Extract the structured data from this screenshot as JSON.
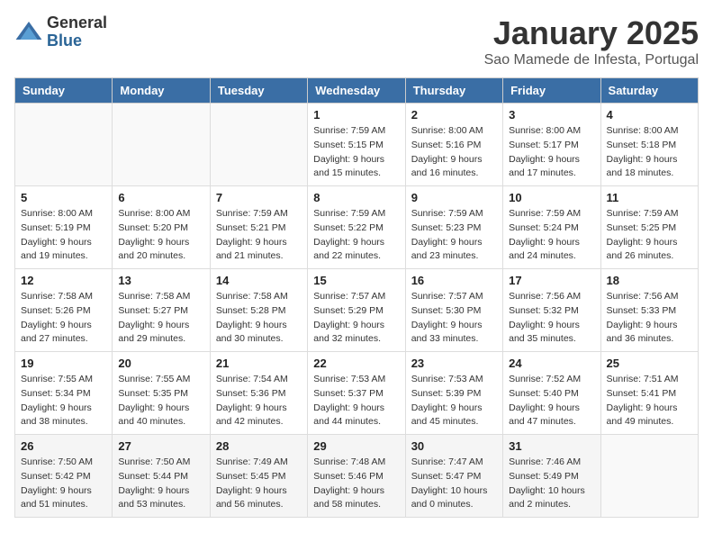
{
  "header": {
    "logo_general": "General",
    "logo_blue": "Blue",
    "title": "January 2025",
    "subtitle": "Sao Mamede de Infesta, Portugal"
  },
  "days_of_week": [
    "Sunday",
    "Monday",
    "Tuesday",
    "Wednesday",
    "Thursday",
    "Friday",
    "Saturday"
  ],
  "weeks": [
    [
      {
        "day": "",
        "info": ""
      },
      {
        "day": "",
        "info": ""
      },
      {
        "day": "",
        "info": ""
      },
      {
        "day": "1",
        "info": "Sunrise: 7:59 AM\nSunset: 5:15 PM\nDaylight: 9 hours\nand 15 minutes."
      },
      {
        "day": "2",
        "info": "Sunrise: 8:00 AM\nSunset: 5:16 PM\nDaylight: 9 hours\nand 16 minutes."
      },
      {
        "day": "3",
        "info": "Sunrise: 8:00 AM\nSunset: 5:17 PM\nDaylight: 9 hours\nand 17 minutes."
      },
      {
        "day": "4",
        "info": "Sunrise: 8:00 AM\nSunset: 5:18 PM\nDaylight: 9 hours\nand 18 minutes."
      }
    ],
    [
      {
        "day": "5",
        "info": "Sunrise: 8:00 AM\nSunset: 5:19 PM\nDaylight: 9 hours\nand 19 minutes."
      },
      {
        "day": "6",
        "info": "Sunrise: 8:00 AM\nSunset: 5:20 PM\nDaylight: 9 hours\nand 20 minutes."
      },
      {
        "day": "7",
        "info": "Sunrise: 7:59 AM\nSunset: 5:21 PM\nDaylight: 9 hours\nand 21 minutes."
      },
      {
        "day": "8",
        "info": "Sunrise: 7:59 AM\nSunset: 5:22 PM\nDaylight: 9 hours\nand 22 minutes."
      },
      {
        "day": "9",
        "info": "Sunrise: 7:59 AM\nSunset: 5:23 PM\nDaylight: 9 hours\nand 23 minutes."
      },
      {
        "day": "10",
        "info": "Sunrise: 7:59 AM\nSunset: 5:24 PM\nDaylight: 9 hours\nand 24 minutes."
      },
      {
        "day": "11",
        "info": "Sunrise: 7:59 AM\nSunset: 5:25 PM\nDaylight: 9 hours\nand 26 minutes."
      }
    ],
    [
      {
        "day": "12",
        "info": "Sunrise: 7:58 AM\nSunset: 5:26 PM\nDaylight: 9 hours\nand 27 minutes."
      },
      {
        "day": "13",
        "info": "Sunrise: 7:58 AM\nSunset: 5:27 PM\nDaylight: 9 hours\nand 29 minutes."
      },
      {
        "day": "14",
        "info": "Sunrise: 7:58 AM\nSunset: 5:28 PM\nDaylight: 9 hours\nand 30 minutes."
      },
      {
        "day": "15",
        "info": "Sunrise: 7:57 AM\nSunset: 5:29 PM\nDaylight: 9 hours\nand 32 minutes."
      },
      {
        "day": "16",
        "info": "Sunrise: 7:57 AM\nSunset: 5:30 PM\nDaylight: 9 hours\nand 33 minutes."
      },
      {
        "day": "17",
        "info": "Sunrise: 7:56 AM\nSunset: 5:32 PM\nDaylight: 9 hours\nand 35 minutes."
      },
      {
        "day": "18",
        "info": "Sunrise: 7:56 AM\nSunset: 5:33 PM\nDaylight: 9 hours\nand 36 minutes."
      }
    ],
    [
      {
        "day": "19",
        "info": "Sunrise: 7:55 AM\nSunset: 5:34 PM\nDaylight: 9 hours\nand 38 minutes."
      },
      {
        "day": "20",
        "info": "Sunrise: 7:55 AM\nSunset: 5:35 PM\nDaylight: 9 hours\nand 40 minutes."
      },
      {
        "day": "21",
        "info": "Sunrise: 7:54 AM\nSunset: 5:36 PM\nDaylight: 9 hours\nand 42 minutes."
      },
      {
        "day": "22",
        "info": "Sunrise: 7:53 AM\nSunset: 5:37 PM\nDaylight: 9 hours\nand 44 minutes."
      },
      {
        "day": "23",
        "info": "Sunrise: 7:53 AM\nSunset: 5:39 PM\nDaylight: 9 hours\nand 45 minutes."
      },
      {
        "day": "24",
        "info": "Sunrise: 7:52 AM\nSunset: 5:40 PM\nDaylight: 9 hours\nand 47 minutes."
      },
      {
        "day": "25",
        "info": "Sunrise: 7:51 AM\nSunset: 5:41 PM\nDaylight: 9 hours\nand 49 minutes."
      }
    ],
    [
      {
        "day": "26",
        "info": "Sunrise: 7:50 AM\nSunset: 5:42 PM\nDaylight: 9 hours\nand 51 minutes."
      },
      {
        "day": "27",
        "info": "Sunrise: 7:50 AM\nSunset: 5:44 PM\nDaylight: 9 hours\nand 53 minutes."
      },
      {
        "day": "28",
        "info": "Sunrise: 7:49 AM\nSunset: 5:45 PM\nDaylight: 9 hours\nand 56 minutes."
      },
      {
        "day": "29",
        "info": "Sunrise: 7:48 AM\nSunset: 5:46 PM\nDaylight: 9 hours\nand 58 minutes."
      },
      {
        "day": "30",
        "info": "Sunrise: 7:47 AM\nSunset: 5:47 PM\nDaylight: 10 hours\nand 0 minutes."
      },
      {
        "day": "31",
        "info": "Sunrise: 7:46 AM\nSunset: 5:49 PM\nDaylight: 10 hours\nand 2 minutes."
      },
      {
        "day": "",
        "info": ""
      }
    ]
  ]
}
